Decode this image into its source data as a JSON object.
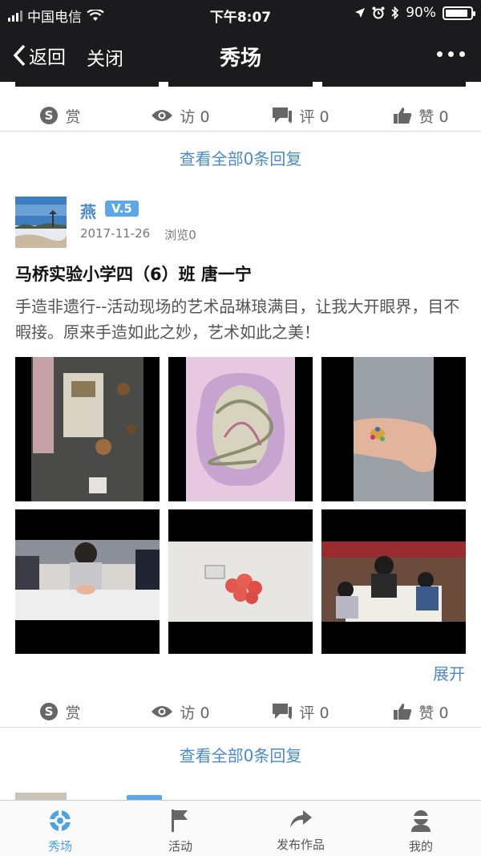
{
  "status_bar": {
    "carrier": "中国电信",
    "time": "下午8:07",
    "battery": "90%",
    "battery_level": 0.9
  },
  "nav": {
    "back_label": "返回",
    "close_label": "关闭",
    "title": "秀场"
  },
  "actions": {
    "reward_label": "赏",
    "visits_label": "访 0",
    "comments_label": "评 0",
    "likes_label": "赞 0"
  },
  "view_all_replies": "查看全部0条回复",
  "post": {
    "author": "燕",
    "level": "V.5",
    "date": "2017-11-26",
    "views": "浏览0",
    "title": "马桥实验小学四（6）班 唐一宁",
    "body": "手造非遗行--活动现场的艺术品琳琅满目，让我大开眼界，目不暇接。原来手造如此之妙，艺术如此之美！",
    "expand_label": "展开"
  },
  "tabs": [
    {
      "label": "秀场",
      "icon": "show-icon"
    },
    {
      "label": "活动",
      "icon": "flag-icon"
    },
    {
      "label": "发布作品",
      "icon": "share-icon"
    },
    {
      "label": "我的",
      "icon": "user-icon"
    }
  ],
  "colors": {
    "accent": "#4a8bd0",
    "active_tab": "#4aa3e8",
    "header_bg": "#1b1b1d",
    "level_badge": "#5aa9e6"
  }
}
